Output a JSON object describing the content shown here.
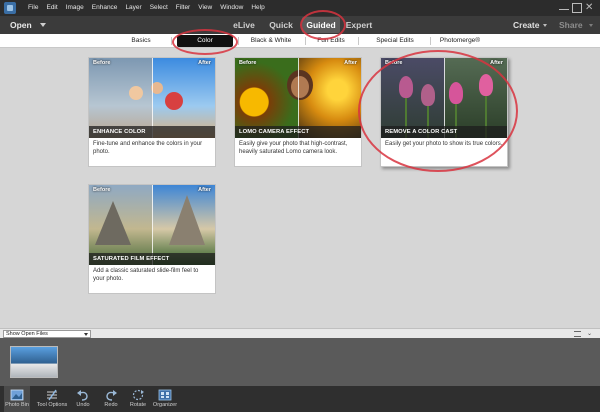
{
  "menubar": {
    "items": [
      "File",
      "Edit",
      "Image",
      "Enhance",
      "Layer",
      "Select",
      "Filter",
      "View",
      "Window",
      "Help"
    ]
  },
  "modebar": {
    "open": "Open",
    "tabs": [
      "eLive",
      "Quick",
      "Guided",
      "Expert"
    ],
    "create": "Create",
    "share": "Share"
  },
  "subtabs": [
    "Basics",
    "Color",
    "Black & White",
    "Fun Edits",
    "Special Edits",
    "Photomerge®"
  ],
  "cards": [
    {
      "before": "Before",
      "after": "After",
      "title": "ENHANCE COLOR",
      "desc": "Fine-tune and enhance the colors in your photo."
    },
    {
      "before": "Before",
      "after": "After",
      "title": "LOMO CAMERA EFFECT",
      "desc": "Easily give your photo that high-contrast, heavily saturated Lomo camera look."
    },
    {
      "before": "Before",
      "after": "After",
      "title": "REMOVE A COLOR CAST",
      "desc": "Easily get your photo to show its true colors."
    },
    {
      "before": "Before",
      "after": "After",
      "title": "SATURATED FILM EFFECT",
      "desc": "Add a classic saturated slide-film feel to your photo."
    }
  ],
  "bin": {
    "select": "Show Open Files"
  },
  "toolbar": {
    "photo_bin": "Photo Bin",
    "tool_options": "Tool Options",
    "undo": "Undo",
    "redo": "Redo",
    "rotate": "Rotate",
    "organizer": "Organizer"
  },
  "colors": {
    "annotation": "#d8343f",
    "active_tab": "#5b5b5b",
    "active_subtab": "#111111"
  }
}
